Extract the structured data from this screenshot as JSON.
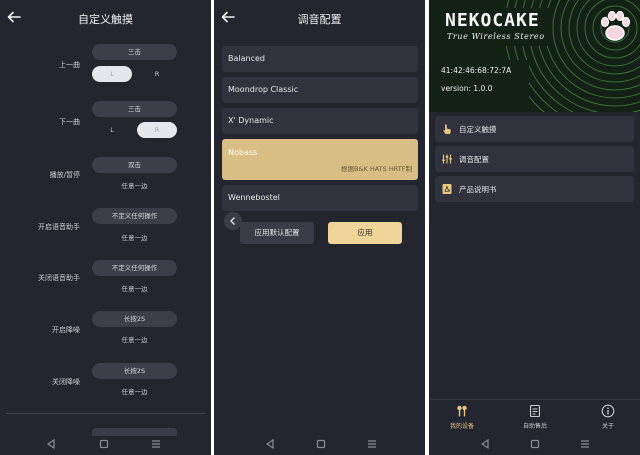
{
  "touch_screen": {
    "title": "自定义触摸",
    "rows": [
      {
        "label": "上一曲",
        "action": "三击",
        "left": "L",
        "right": "R",
        "selected": "L"
      },
      {
        "label": "下一曲",
        "action": "三击",
        "left": "L",
        "right": "R",
        "selected": "R"
      },
      {
        "label": "播放/暂停",
        "action": "双击",
        "side": "任意一边"
      },
      {
        "label": "开启语音助手",
        "action": "不定义任何操作",
        "side": "任意一边"
      },
      {
        "label": "关闭语音助手",
        "action": "不定义任何操作",
        "side": "任意一边"
      },
      {
        "label": "开启降噪",
        "action": "长按2S",
        "side": "任意一边"
      },
      {
        "label": "关闭降噪",
        "action": "长按2S",
        "side": "任意一边"
      }
    ]
  },
  "eq_screen": {
    "title": "调音配置",
    "presets": [
      {
        "name": "Balanced"
      },
      {
        "name": "Moondrop Classic"
      },
      {
        "name": "X' Dynamic"
      },
      {
        "name": "Nobass",
        "description": "根据B&K HATS HRTF制",
        "active": true
      },
      {
        "name": "Wennebostel"
      }
    ],
    "reset_label": "应用默认配置",
    "apply_label": "应用"
  },
  "device_screen": {
    "logo": "NEKOCAKE",
    "tagline": "True Wireless Stereo",
    "mac_address": "41:42:46:68:72:7A",
    "version": "version: 1.0.0",
    "menu": [
      {
        "label": "自定义触摸",
        "icon": "touch-hand-icon"
      },
      {
        "label": "调音配置",
        "icon": "equalizer-icon"
      },
      {
        "label": "产品说明书",
        "icon": "pdf-document-icon"
      }
    ],
    "tabs": [
      {
        "label": "我的设备",
        "icon": "earbuds-icon",
        "active": true
      },
      {
        "label": "自助售后",
        "icon": "service-document-icon"
      },
      {
        "label": "关于",
        "icon": "info-icon"
      }
    ]
  },
  "colors": {
    "background": "#23252f",
    "card": "#30323d",
    "accent_gold": "#d8bd84",
    "apply_button": "#f1d497",
    "hero_green": "#142117"
  }
}
